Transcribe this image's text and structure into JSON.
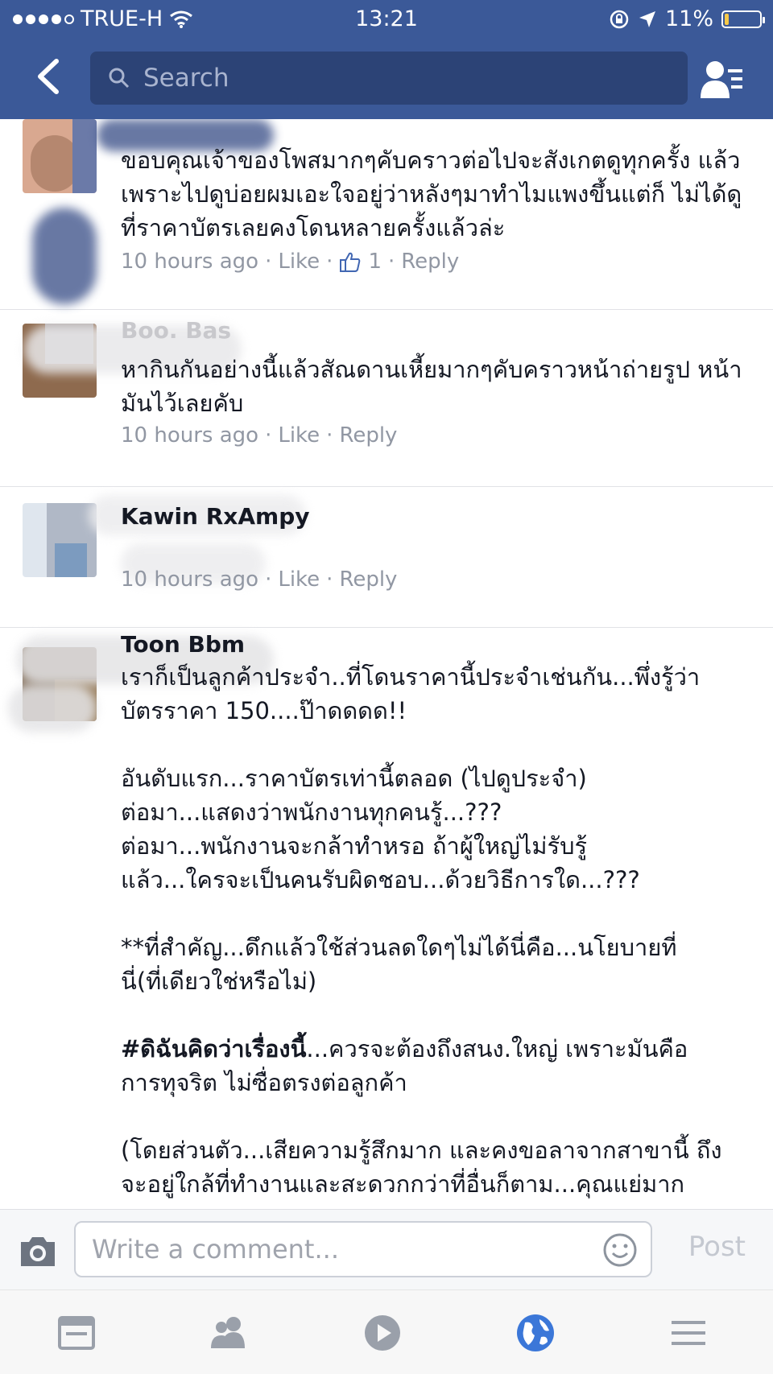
{
  "status_bar": {
    "carrier": "TRUE-H",
    "time": "13:21",
    "battery": "11%",
    "battery_level": 0.11,
    "icons": [
      "signal-dots-icon",
      "wifi-icon",
      "rotation-lock-icon",
      "location-icon",
      "battery-icon"
    ]
  },
  "nav": {
    "back_icon": "back-chevron-icon",
    "search_placeholder": "Search",
    "friends_icon": "friend-requests-icon"
  },
  "comments": [
    {
      "name": "",
      "text": "ขอบคุณเจ้าของโพสมากๆคับคราวต่อไปจะสังเกตดูทุกครั้ง แล้วเพราะไปดูบ่อยผมเอะใจอยู่ว่าหลังๆมาทำไมแพงขึ้นแต่ก็ ไม่ได้ดูที่ราคาบัตรเลยคงโดนหลายครั้งแล้วล่ะ",
      "time": "10 hours ago",
      "like": "Like",
      "like_count": "1",
      "reply": "Reply"
    },
    {
      "name": "Boo. Bas",
      "text": "หากินกันอย่างนี้แล้วสัณดานเหี้ยมากๆคับคราวหน้าถ่ายรูป หน้ามันไว้เลยคับ",
      "time": "10 hours ago",
      "like": "Like",
      "reply": "Reply"
    },
    {
      "name": "Kawin RxAmpy",
      "text": "",
      "time": "10 hours ago",
      "like": "Like",
      "reply": "Reply"
    },
    {
      "name": "Toon Bbm",
      "text": "เราก็เป็นลูกค้าประจำ..ที่โดนราคานี้ประจำเช่นกัน...พึ่งรู้ว่า\nบัตรราคา 150....ป๊าดดดด!!\n\nอันดับแรก...ราคาบัตรเท่านี้ตลอด (ไปดูประจำ)\nต่อมา...แสดงว่าพนักงานทุกคนรู้...???\nต่อมา...พนักงานจะกล้าทำหรอ ถ้าผู้ใหญ่ไม่รับรู้\nแล้ว...ใครจะเป็นคนรับผิดชอบ...ด้วยวิธีการใด...???\n\n**ที่สำคัญ...ดึกแล้วใช้ส่วนลดใดๆไม่ได้นี่คือ...นโยบายที่\nนี่(ที่เดียวใช่หรือไม่)",
      "hashtag": "#ดิฉันคิดว่าเรื่องนี้",
      "text2": "...ควรจะต้องถึงสนง.ใหญ่ เพราะมันคือ\nการทุจริต ไม่ซื่อตรงต่อลูกค้า\n\n(โดยส่วนตัว...เสียความรู้สึกมาก และคงขอลาจากสาขานี้ ถึง\nจะอยู่ใกล้ที่ทำงานและสะดวกกว่าที่อื่นก็ตาม...คุณแย่มาก"
    }
  ],
  "composer": {
    "camera_icon": "camera-icon",
    "placeholder": "Write a comment...",
    "smiley_icon": "emoji-icon",
    "post": "Post"
  },
  "tabbar": {
    "icons": [
      "news-feed-icon",
      "friends-icon",
      "video-icon",
      "notifications-globe-icon",
      "menu-icon"
    ],
    "active": "notifications-globe-icon",
    "active_color": "#3b77d8"
  }
}
